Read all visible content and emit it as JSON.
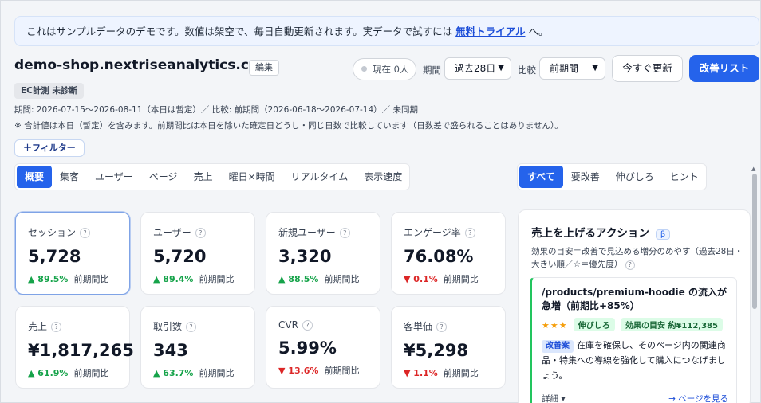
{
  "banner": {
    "text": "これはサンプルデータのデモです。数値は架空で、毎日自動更新されます。実データで試すには ",
    "link": "無料トライアル",
    "suffix": " へ。"
  },
  "header": {
    "title": "demo-shop.nextriseanalytics.com",
    "edit_label": "編集",
    "status_badge": "EC計測 未診断",
    "period_line": "期間: 2026-07-15〜2026-08-11（本日は暫定）／ 比較: 前期間（2026-06-18〜2026-07-14）／ 未同期",
    "note_line": "※ 合計値は本日（暫定）を含みます。前期間比は本日を除いた確定日どうし・同じ日数で比較しています（日数差で盛られることはありません）。",
    "filter_label": "＋フィルター"
  },
  "controls": {
    "live_label": "現在 0人",
    "period_label": "期間",
    "period_value": "過去28日",
    "compare_label": "比較",
    "compare_value": "前期間",
    "refresh_label": "今すぐ更新",
    "improve_label": "改善リスト"
  },
  "tabs": [
    "概要",
    "集客",
    "ユーザー",
    "ページ",
    "売上",
    "曜日×時間",
    "リアルタイム",
    "表示速度"
  ],
  "filter_tabs": [
    "すべて",
    "要改善",
    "伸びしろ",
    "ヒント"
  ],
  "kpis": [
    {
      "label": "セッション",
      "value": "5,728",
      "delta": "▲ 89.5%",
      "dir": "up",
      "cmp": "前期間比"
    },
    {
      "label": "ユーザー",
      "value": "5,720",
      "delta": "▲ 89.4%",
      "dir": "up",
      "cmp": "前期間比"
    },
    {
      "label": "新規ユーザー",
      "value": "3,320",
      "delta": "▲ 88.5%",
      "dir": "up",
      "cmp": "前期間比"
    },
    {
      "label": "エンゲージ率",
      "value": "76.08%",
      "delta": "▼ 0.1%",
      "dir": "down",
      "cmp": "前期間比"
    },
    {
      "label": "売上",
      "value": "¥1,817,265",
      "delta": "▲ 61.9%",
      "dir": "up",
      "cmp": "前期間比"
    },
    {
      "label": "取引数",
      "value": "343",
      "delta": "▲ 63.7%",
      "dir": "up",
      "cmp": "前期間比"
    },
    {
      "label": "CVR",
      "value": "5.99%",
      "delta": "▼ 13.6%",
      "dir": "down",
      "cmp": "前期間比"
    },
    {
      "label": "客単価",
      "value": "¥5,298",
      "delta": "▼ 1.1%",
      "dir": "down",
      "cmp": "前期間比"
    }
  ],
  "help_glyph": "?",
  "actions_panel": {
    "title": "売上を上げるアクション",
    "beta": "β",
    "subtitle": "効果の目安＝改善で見込める増分のめやす（過去28日・大きい順／☆＝優先度）",
    "item": {
      "headline": "/products/premium-hoodie の流入が急増（前期比+85%）",
      "stars": "★★★",
      "tag1": "伸びしろ",
      "tag2": "効果の目安 約¥112,385",
      "proposal_label": "改善案",
      "text": "在庫を確保し、そのページ内の関連商品・特集への導線を強化して購入につなげましょう。",
      "detail_label": "詳細 ▾",
      "link_label": "→ ページを見る"
    }
  },
  "colors": {
    "accent": "#2563eb",
    "up": "#16a34a",
    "down": "#dc2626"
  }
}
